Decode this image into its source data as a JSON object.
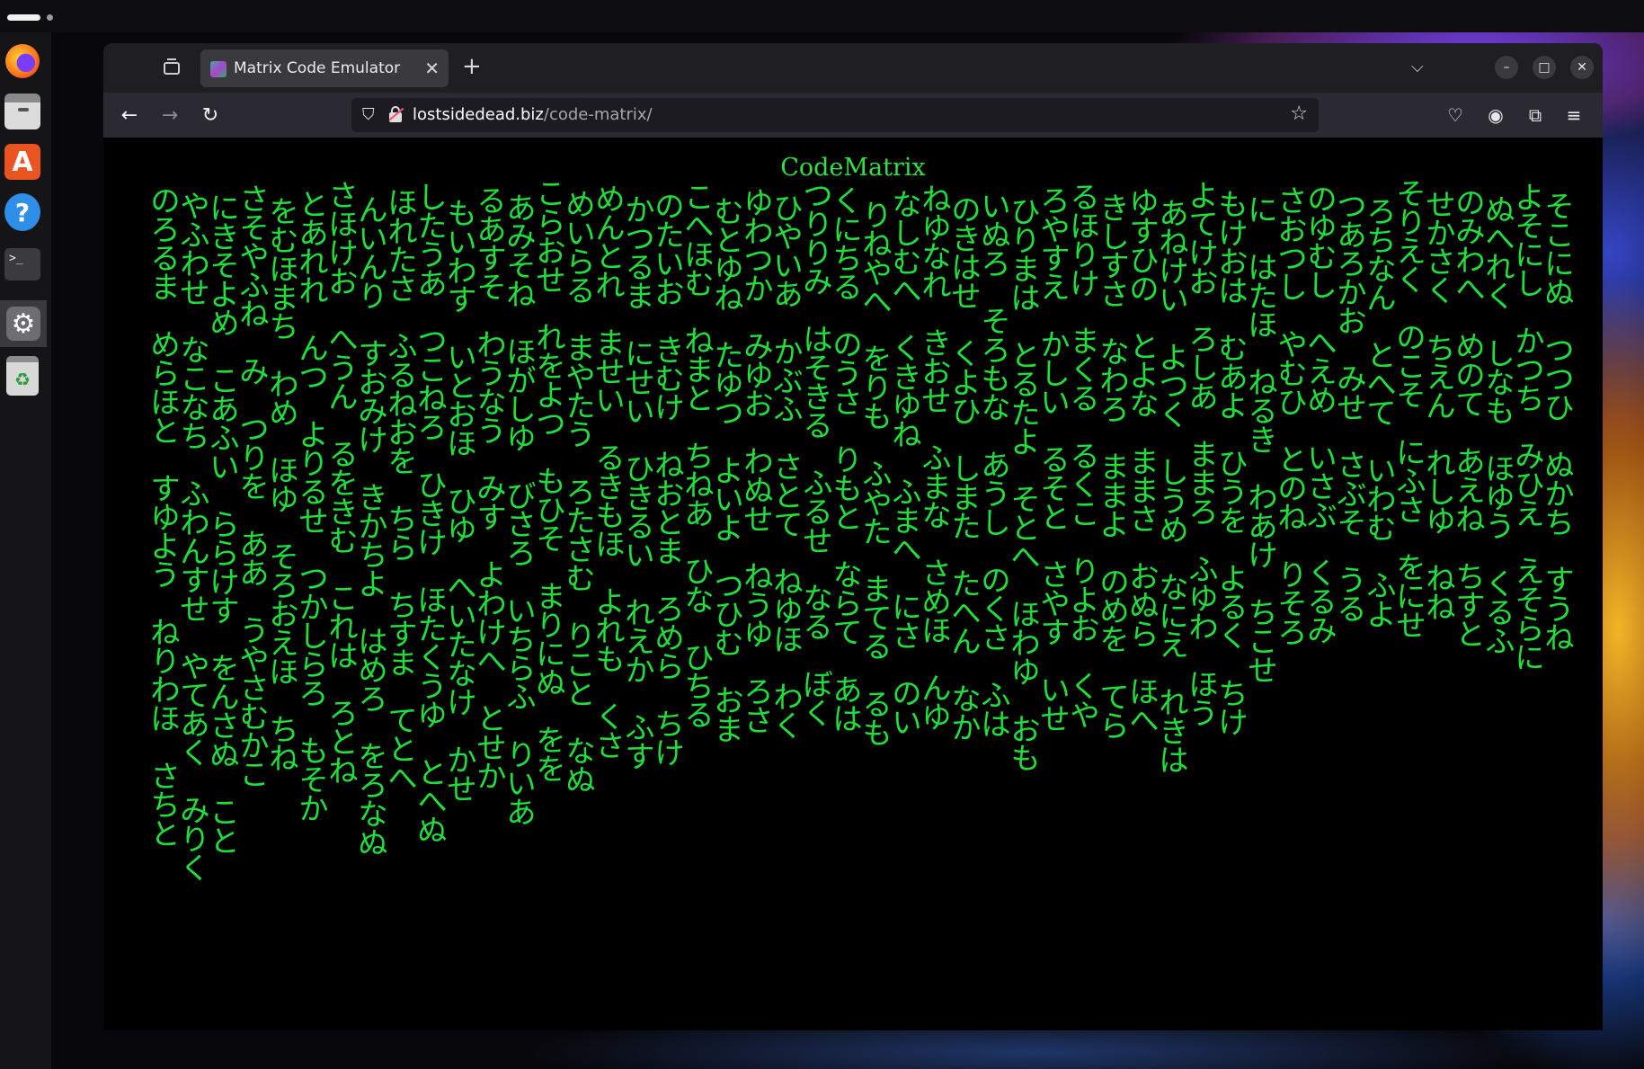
{
  "desktop": {
    "dock": [
      {
        "name": "Firefox",
        "icon": "firefox-icon"
      },
      {
        "name": "Files",
        "icon": "files-icon"
      },
      {
        "name": "App Center",
        "icon": "app-store-icon",
        "glyph": "A"
      },
      {
        "name": "Help",
        "icon": "help-icon",
        "glyph": "?"
      },
      {
        "name": "Terminal",
        "icon": "terminal-icon",
        "glyph": ">_"
      },
      {
        "name": "Settings",
        "icon": "gear-icon",
        "glyph": "⚙"
      },
      {
        "name": "Trash",
        "icon": "recycle-icon",
        "glyph": "♻"
      }
    ]
  },
  "browser": {
    "tab": {
      "title": "Matrix Code Emulator",
      "close_glyph": "✕"
    },
    "newtab_glyph": "+",
    "alltabs_glyph": "⌵",
    "window_controls": {
      "minimize": "–",
      "maximize": "□",
      "close": "✕"
    },
    "nav": {
      "back": "←",
      "forward": "→",
      "reload": "↻"
    },
    "url": {
      "domain": "lostsidedead.biz",
      "path": "/code-matrix/"
    },
    "toolbar": {
      "pocket": "♡",
      "account": "◉",
      "extensions": "⧉",
      "menu": "≡"
    }
  },
  "page": {
    "title": "CodeMatrix",
    "text_color": "#1fe03a",
    "columns": [
      "のろるま　めらほと　すゆよう　ねりわほ　さちと",
      "やふわせ　なこなち　ふわんすせ　やてあく　みりく",
      "にきそよめ　こあふい　ららけす　をんさぬ　こと",
      "さそやふね　み　つりを　ああ　うやさむかこ",
      "をむほまち　わめ　ほゆ　そろおえほ　ちね",
      "とあれれ　んつ　よりるせ　つかしらろ　もそか",
      "さほけお　へうん　るをきむ　これは　ろとね",
      "んいんり　すおみけ　きかちよ　はめろ　をろなぬ",
      "ほれたさ　ふるねおを　ちら　ちすま　てとへ",
      "したうあ　つこねろ　ひきけ　ほたくうゆ　とへぬ",
      "もいわす　いとおほ　ひゆ　へいたなけ　かせ",
      "るあすそ　わうなう　みす　よわけへ　とせか",
      "あみそね　ほがしゆ　びさろ　いちらふ　りいあ",
      "こらおせ　れをよつ　もひそ　まりにぬ　をを",
      "めいらる　まやたう　ろたさむ　りこと　なぬ",
      "めんとれ　ませい　るきもほ　よれも　くさ",
      "かつるま　にせい　ひきるい　れえか　ふす",
      "のたいお　きむけ　ねおとま　ろめら　ちけ",
      "こへほむ　ねまと　ちねあ　ひな　ひちる",
      "むとゆね　たゆつ　よいよ　つひむ　おま",
      "ゆわつか　みゆお　わぬせ　ねうゆ　ろさ",
      "ひやいあ　かぶふ　さとて　ねゆほ　わく",
      "つりりみ　はそきる　ふるせ　なる　ぼく",
      "くにちる　のうさ　りもと　ならて　あは",
      "りねやへ　をりも　ふやた　まてる　るも",
      "なしむへ　くきゆね　ふまへ　にさ　のい",
      "ねゆなれ　きおせ　ふまな　さめほ　んゆ",
      "のきはせ　くよひ　しまた　たへん　なか",
      "いぬろ　そろもな　あうし　のくさ　ふは",
      "ひりまは　とるたよ　そとへ　ほわゆ　おも",
      "ろやすえ　かしい　るそと　さやす　いせ",
      "るほりけ　まくる　るくこ　りよお　くや",
      "きしすさ　なわろ　ままよ　のめを　てら",
      "ゆすひの　とよな　ままさ　おぬら　ほへ",
      "あねけい　よつく　しうめ　なにえ　れきは",
      "よてけお　ろしあ　ままろ　ふゆわ　ほう",
      "もけおは　むあよ　ひうを　よるく　ちけ",
      "に　はたほ　ねるき　わあけ　ちこせ",
      "さおつし　やむひ　とのね　りそろ",
      "のゆむし　へえめ　いさぶ　くるみ",
      "つあろかお　みせ　さぶそ　うる",
      "ろちなん　とへて　いわむ　ふよ",
      "そりえく　のこそ　にふさ　をにせ",
      "せかさく　ちえん　れしゆ　ねね",
      "のみわへ　めのて　あえね　ちすと",
      "ぬへれく　しなも　ほゆう　くるふ",
      "よそにし　かつち　みひえ　えそらに",
      "そこにぬ　つつひ　ぬかち　すうね"
    ]
  }
}
